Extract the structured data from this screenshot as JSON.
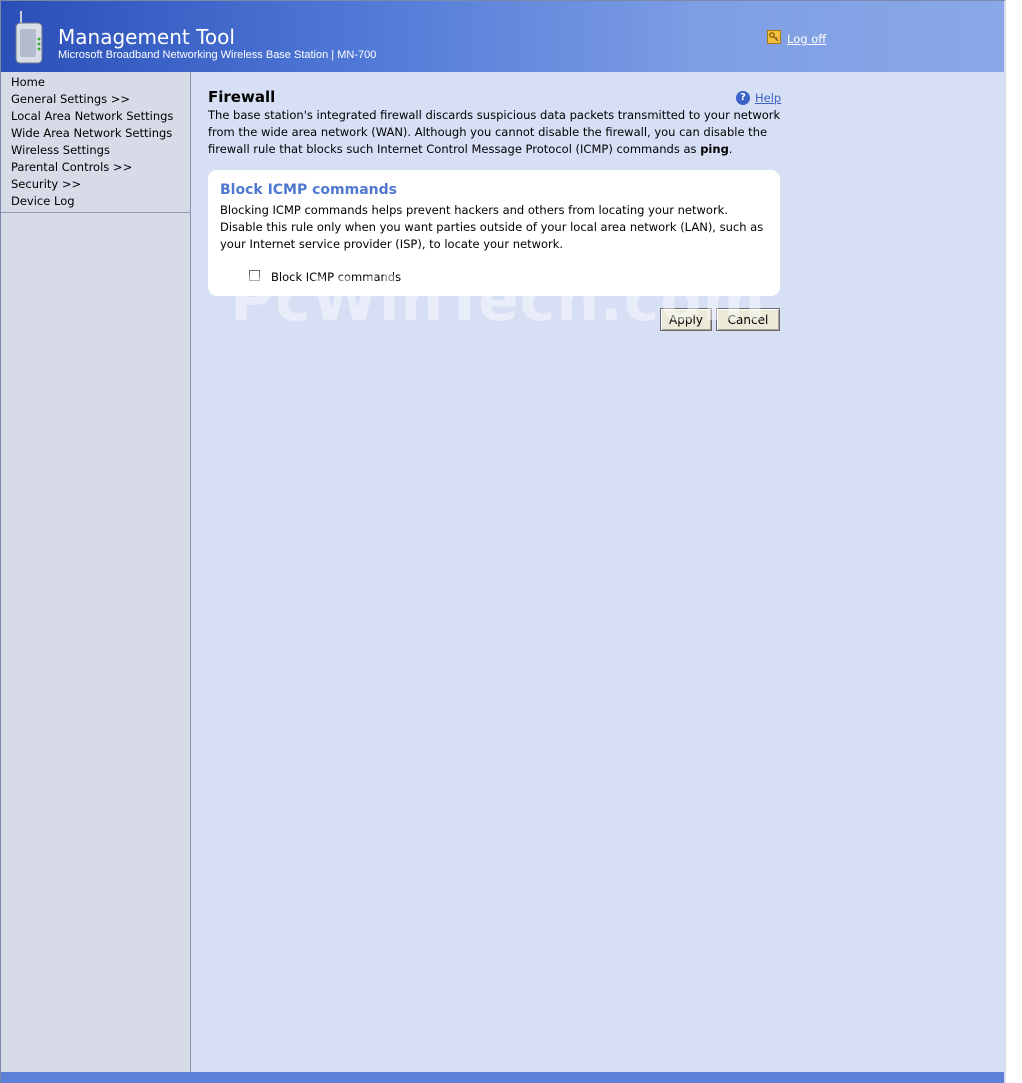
{
  "header": {
    "title": "Management Tool",
    "subtitle": "Microsoft Broadband Networking Wireless Base Station | MN-700",
    "logoff_label": "Log off",
    "logo_icon": "base-station-icon",
    "logoff_icon": "key-icon"
  },
  "sidebar": {
    "items": [
      {
        "label": "Home"
      },
      {
        "label": "General Settings >>"
      },
      {
        "label": "Local Area Network Settings"
      },
      {
        "label": "Wide Area Network Settings"
      },
      {
        "label": "Wireless Settings"
      },
      {
        "label": "Parental Controls >>"
      },
      {
        "label": "Security >>"
      },
      {
        "label": "Device Log"
      }
    ]
  },
  "main": {
    "title": "Firewall",
    "help_label": "Help",
    "help_icon": "help-icon",
    "intro_part1": "The base station's integrated firewall discards suspicious data packets transmitted to your network from the wide area network (WAN). Although you cannot disable the firewall, you can disable the firewall rule that blocks such Internet Control Message Protocol (ICMP) commands as ",
    "intro_bold": "ping",
    "intro_end": ".",
    "panel": {
      "title": "Block ICMP commands",
      "description": "Blocking ICMP commands helps prevent hackers and others from locating your network. Disable this rule only when you want parties outside of your local area network (LAN), such as your Internet service provider (ISP), to locate your network.",
      "checkbox_label": "Block ICMP commands",
      "checkbox_checked": false
    },
    "apply_label": "Apply",
    "cancel_label": "Cancel"
  },
  "watermark": "PcWinTech.com",
  "colors": {
    "header_start": "#2a4fb8",
    "header_end": "#8aa8e8",
    "main_bg": "#d6dff4",
    "sidebar_bg": "#d6dbe7",
    "panel_title": "#4f78cf",
    "link": "#3b63c8"
  }
}
